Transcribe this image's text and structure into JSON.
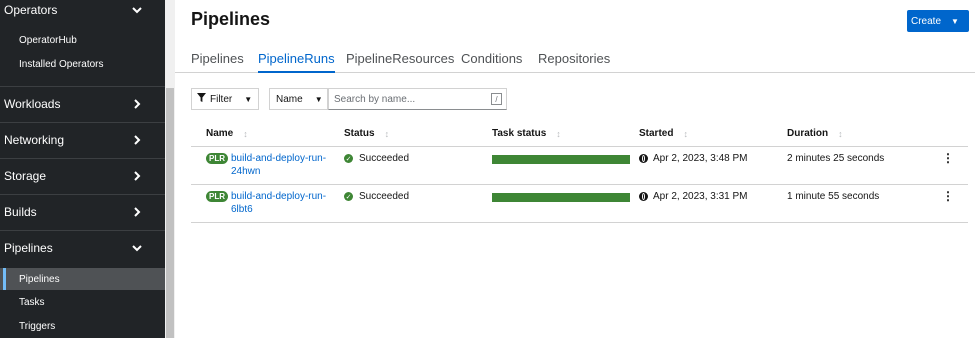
{
  "sidebar": {
    "operators": {
      "label": "Operators",
      "items": [
        "OperatorHub",
        "Installed Operators"
      ]
    },
    "groups": [
      "Workloads",
      "Networking",
      "Storage",
      "Builds"
    ],
    "pipelines": {
      "label": "Pipelines",
      "items": [
        "Pipelines",
        "Tasks",
        "Triggers"
      ]
    }
  },
  "header": {
    "title": "Pipelines",
    "create_label": "Create"
  },
  "tabs": [
    "Pipelines",
    "PipelineRuns",
    "PipelineResources",
    "Conditions",
    "Repositories"
  ],
  "toolbar": {
    "filter_label": "Filter",
    "name_select": "Name",
    "search_placeholder": "Search by name...",
    "search_hint": "/"
  },
  "table": {
    "columns": [
      "Name",
      "Status",
      "Task status",
      "Started",
      "Duration"
    ],
    "rows": [
      {
        "badge": "PLR",
        "name_line1": "build-and-deploy-run-",
        "name_line2": "24hwn",
        "status": "Succeeded",
        "task_progress": 1.0,
        "started": "Apr 2, 2023, 3:48 PM",
        "duration": "2 minutes 25 seconds"
      },
      {
        "badge": "PLR",
        "name_line1": "build-and-deploy-run-",
        "name_line2": "6lbt6",
        "status": "Succeeded",
        "task_progress": 1.0,
        "started": "Apr 2, 2023, 3:31 PM",
        "duration": "1 minute 55 seconds"
      }
    ]
  },
  "colors": {
    "sidebar_bg": "#212427",
    "accent": "#0066cc",
    "success": "#3e8635"
  }
}
